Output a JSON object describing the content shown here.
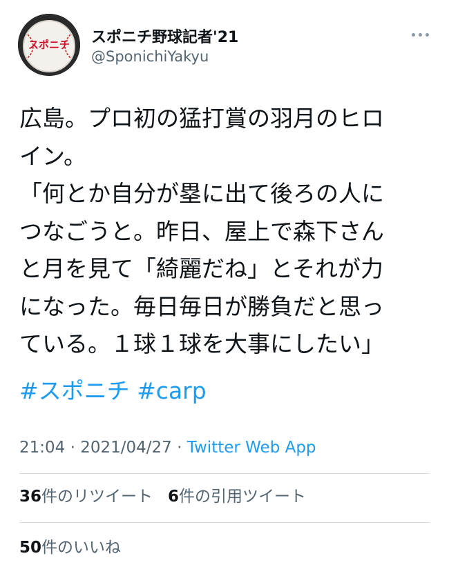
{
  "author": {
    "display_name": "スポニチ野球記者'21",
    "handle": "@SponichiYakyu",
    "avatar_text": "スポニチ"
  },
  "tweet": {
    "lines": [
      "広島。プロ初の猛打賞の羽月のヒロ",
      "イン。",
      "「何とか自分が塁に出て後ろの人に",
      "つなごうと。昨日、屋上で森下さん",
      "と月を見て「綺麗だね」とそれが力",
      "になった。毎日毎日が勝負だと思っ",
      "ている。１球１球を大事にしたい」"
    ],
    "hashtags": [
      "#スポニチ",
      "#carp"
    ]
  },
  "meta": {
    "time": "21:04",
    "separator": " · ",
    "date": "2021/04/27",
    "source": "Twitter Web App"
  },
  "stats": {
    "retweets_count": "36",
    "retweets_label": "件のリツイート",
    "quotes_count": "6",
    "quotes_label": "件の引用ツイート",
    "likes_count": "50",
    "likes_label": "件のいいね"
  },
  "icons": {
    "more": "more-horizontal-icon",
    "avatar": "baseball-avatar"
  },
  "colors": {
    "link": "#1d9bf0",
    "secondary_text": "#536471",
    "primary_text": "#0f1419",
    "divider": "#d4dadf"
  }
}
